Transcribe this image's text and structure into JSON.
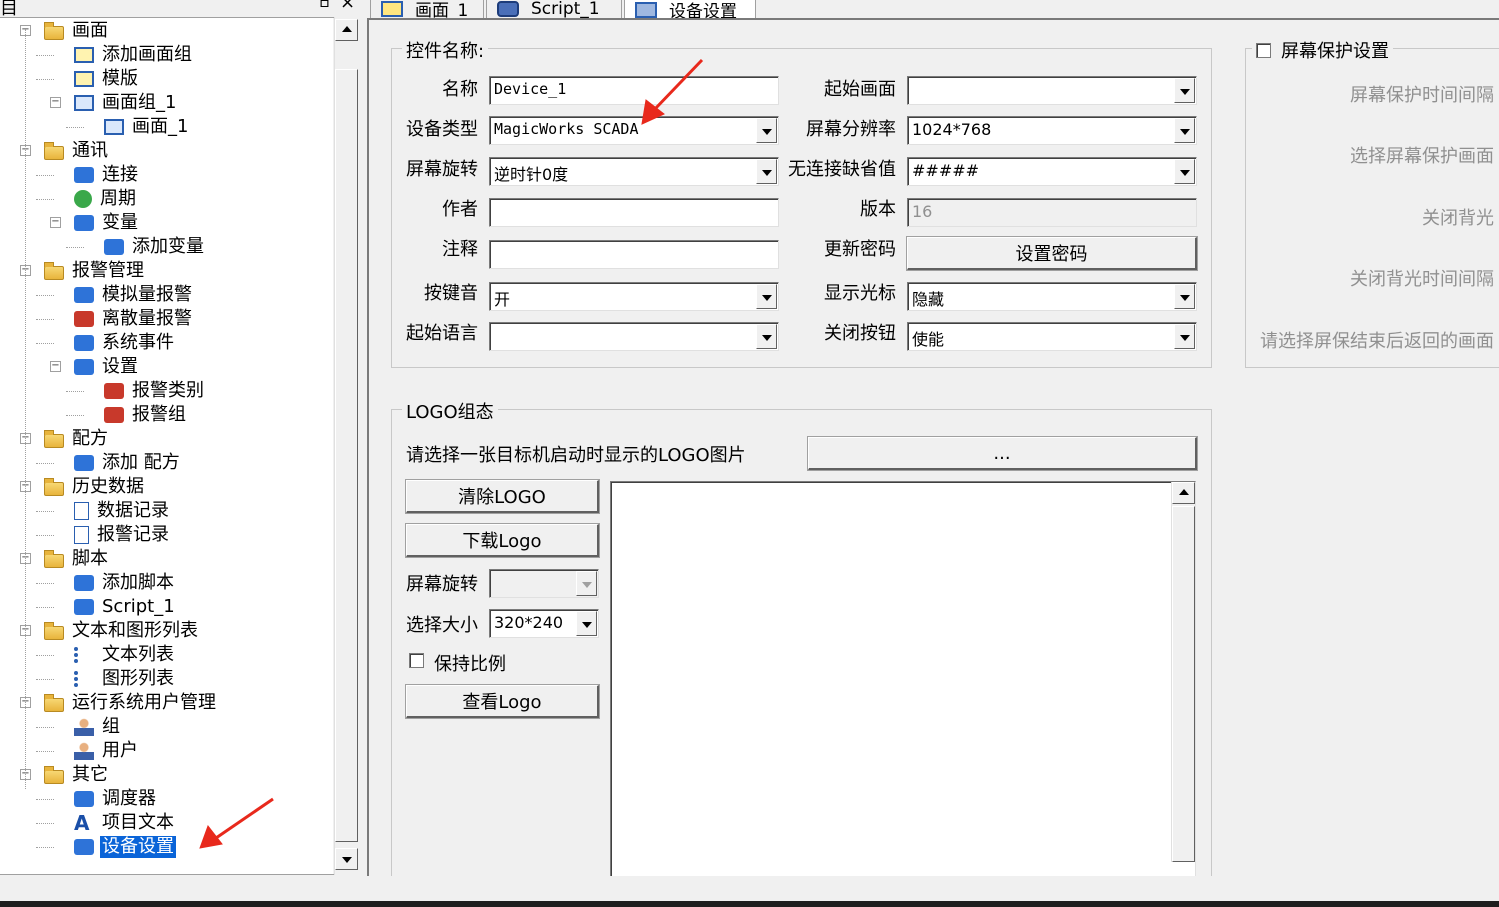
{
  "left_panel": {
    "header_title": "目",
    "pin_glyph": "ㅁ",
    "close_glyph": "×",
    "tree": [
      {
        "label": "画面",
        "icon": "folder-screen-icon",
        "level": 0,
        "expander": "−"
      },
      {
        "label": "添加画面组",
        "icon": "add-screen-group-icon",
        "level": 1
      },
      {
        "label": "模版",
        "icon": "template-icon",
        "level": 1
      },
      {
        "label": "画面组_1",
        "icon": "screen-group-icon",
        "level": 1,
        "expander": "−"
      },
      {
        "label": "画面_1",
        "icon": "screen-icon",
        "level": 2
      },
      {
        "label": "通讯",
        "icon": "folder-comm-icon",
        "level": 0,
        "expander": "−"
      },
      {
        "label": "连接",
        "icon": "connection-icon",
        "level": 1
      },
      {
        "label": "周期",
        "icon": "cycle-icon",
        "level": 1
      },
      {
        "label": "变量",
        "icon": "variable-icon",
        "level": 1,
        "expander": "−"
      },
      {
        "label": "添加变量",
        "icon": "add-variable-icon",
        "level": 2
      },
      {
        "label": "报警管理",
        "icon": "folder-alarm-icon",
        "level": 0,
        "expander": "−"
      },
      {
        "label": "模拟量报警",
        "icon": "analog-alarm-icon",
        "level": 1
      },
      {
        "label": "离散量报警",
        "icon": "discrete-alarm-icon",
        "level": 1
      },
      {
        "label": "系统事件",
        "icon": "system-event-icon",
        "level": 1
      },
      {
        "label": "设置",
        "icon": "settings-icon",
        "level": 1,
        "expander": "−"
      },
      {
        "label": "报警类别",
        "icon": "alarm-category-icon",
        "level": 2
      },
      {
        "label": "报警组",
        "icon": "alarm-group-icon",
        "level": 2
      },
      {
        "label": "配方",
        "icon": "folder-recipe-icon",
        "level": 0,
        "expander": "−"
      },
      {
        "label": "添加 配方",
        "icon": "add-recipe-icon",
        "level": 1
      },
      {
        "label": "历史数据",
        "icon": "folder-history-icon",
        "level": 0,
        "expander": "−"
      },
      {
        "label": "数据记录",
        "icon": "data-log-icon",
        "level": 1
      },
      {
        "label": "报警记录",
        "icon": "alarm-log-icon",
        "level": 1
      },
      {
        "label": "脚本",
        "icon": "folder-script-icon",
        "level": 0,
        "expander": "−"
      },
      {
        "label": "添加脚本",
        "icon": "add-script-icon",
        "level": 1
      },
      {
        "label": "Script_1",
        "icon": "script-icon",
        "level": 1
      },
      {
        "label": "文本和图形列表",
        "icon": "folder-list-icon",
        "level": 0,
        "expander": "−"
      },
      {
        "label": "文本列表",
        "icon": "text-list-icon",
        "level": 1
      },
      {
        "label": "图形列表",
        "icon": "graphic-list-icon",
        "level": 1
      },
      {
        "label": "运行系统用户管理",
        "icon": "folder-user-icon",
        "level": 0,
        "expander": "−"
      },
      {
        "label": "组",
        "icon": "group-icon",
        "level": 1
      },
      {
        "label": "用户",
        "icon": "user-icon",
        "level": 1
      },
      {
        "label": "其它",
        "icon": "folder-other-icon",
        "level": 0,
        "expander": "−"
      },
      {
        "label": "调度器",
        "icon": "scheduler-icon",
        "level": 1
      },
      {
        "label": "项目文本",
        "icon": "project-text-icon",
        "level": 1
      },
      {
        "label": "设备设置",
        "icon": "device-settings-icon",
        "level": 1,
        "selected": true
      }
    ]
  },
  "tabs": [
    {
      "label": "画面_1",
      "icon": "screen-icon"
    },
    {
      "label": "Script_1",
      "icon": "script-icon"
    },
    {
      "label": "设备设置",
      "icon": "device-settings-icon",
      "active": true
    }
  ],
  "control_group": {
    "title": "控件名称:",
    "name_label": "名称",
    "name_value": "Device_1",
    "device_type_label": "设备类型",
    "device_type_value": "MagicWorks SCADA",
    "rotation_label": "屏幕旋转",
    "rotation_value": "逆时针0度",
    "author_label": "作者",
    "author_value": "",
    "comment_label": "注释",
    "comment_value": "",
    "key_sound_label": "按键音",
    "key_sound_value": "开",
    "start_lang_label": "起始语言",
    "start_lang_value": "",
    "start_screen_label": "起始画面",
    "start_screen_value": "",
    "resolution_label": "屏幕分辨率",
    "resolution_value": "1024*768",
    "no_conn_default_label": "无连接缺省值",
    "no_conn_default_value": "#####",
    "version_label": "版本",
    "version_value": "16",
    "update_pwd_label": "更新密码",
    "set_pwd_button": "设置密码",
    "show_cursor_label": "显示光标",
    "show_cursor_value": "隐藏",
    "close_button_label": "关闭按钮",
    "close_button_value": "使能"
  },
  "screensaver_group": {
    "title": "屏幕保护设置",
    "interval_label": "屏幕保护时间间隔",
    "select_screen_label": "选择屏幕保护画面",
    "backlight_off_label": "关闭背光",
    "backlight_interval_label": "关闭背光时间间隔",
    "return_screen_label": "请选择屏保结束后返回的画面"
  },
  "logo_group": {
    "title": "LOGO组态",
    "prompt": "请选择一张目标机启动时显示的LOGO图片",
    "browse_button": "...",
    "clear_button": "清除LOGO",
    "download_button": "下载Logo",
    "rotation_label": "屏幕旋转",
    "rotation_value": "",
    "size_label": "选择大小",
    "size_value": "320*240",
    "keep_ratio_label": "保持比例",
    "view_button": "查看Logo"
  },
  "colors": {
    "selection": "#0a64d8",
    "annotation_arrow": "#e8291c"
  }
}
